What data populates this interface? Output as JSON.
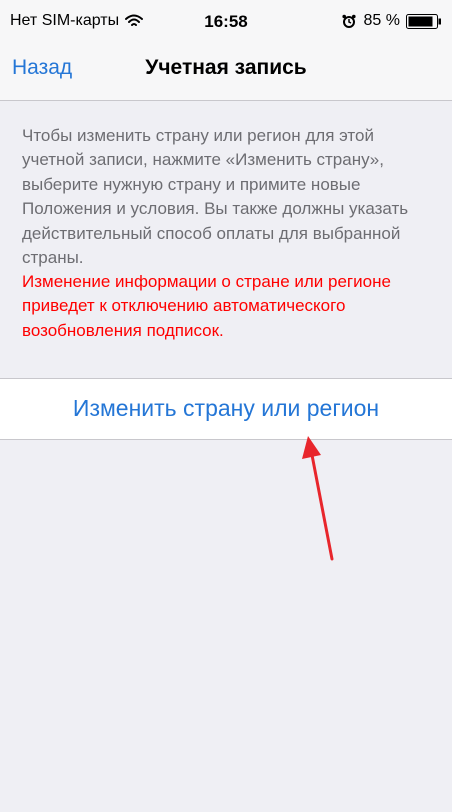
{
  "status_bar": {
    "carrier": "Нет SIM-карты",
    "time": "16:58",
    "battery": "85 %"
  },
  "nav": {
    "back_label": "Назад",
    "title": "Учетная запись"
  },
  "content": {
    "description": "Чтобы изменить страну или регион для этой учетной записи, нажмите «Изменить страну», выберите нужную страну и примите новые Положения и условия. Вы также должны указать действительный способ оплаты для выбранной страны.",
    "warning": "Изменение информации о стране или регионе приведет к отключению автоматического возобновления подписок.",
    "change_button_label": "Изменить страну или регион"
  },
  "colors": {
    "accent": "#2476d6",
    "warning": "#ff0000",
    "annotation_arrow": "#e8262c"
  },
  "icons": [
    "wifi-icon",
    "alarm-icon",
    "battery-icon"
  ]
}
